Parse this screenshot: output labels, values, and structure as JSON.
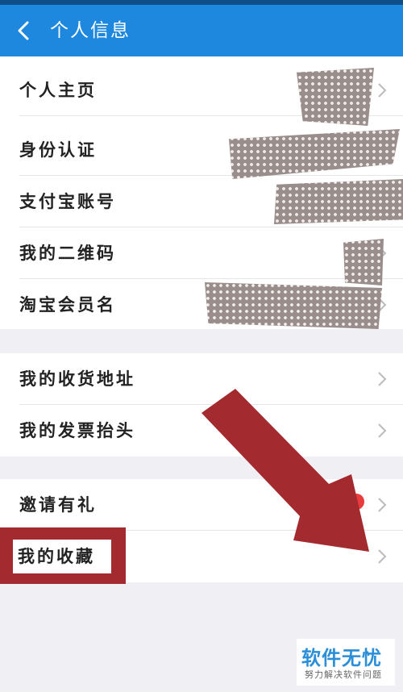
{
  "header": {
    "title": "个人信息"
  },
  "sections": [
    {
      "items": [
        {
          "label": "个人主页"
        },
        {
          "label": "身份认证"
        },
        {
          "label": "支付宝账号"
        },
        {
          "label": "我的二维码"
        },
        {
          "label": "淘宝会员名"
        }
      ]
    },
    {
      "items": [
        {
          "label": "我的收货地址"
        },
        {
          "label": "我的发票抬头"
        }
      ]
    },
    {
      "items": [
        {
          "label": "邀请有礼"
        },
        {
          "label": "我的收藏"
        }
      ]
    }
  ],
  "watermark": {
    "title": "软件无忧",
    "subtitle": "努力解决软件问题"
  },
  "colors": {
    "header": "#1e87de",
    "annotation": "#a32b30",
    "badge": "#e83b3b"
  }
}
